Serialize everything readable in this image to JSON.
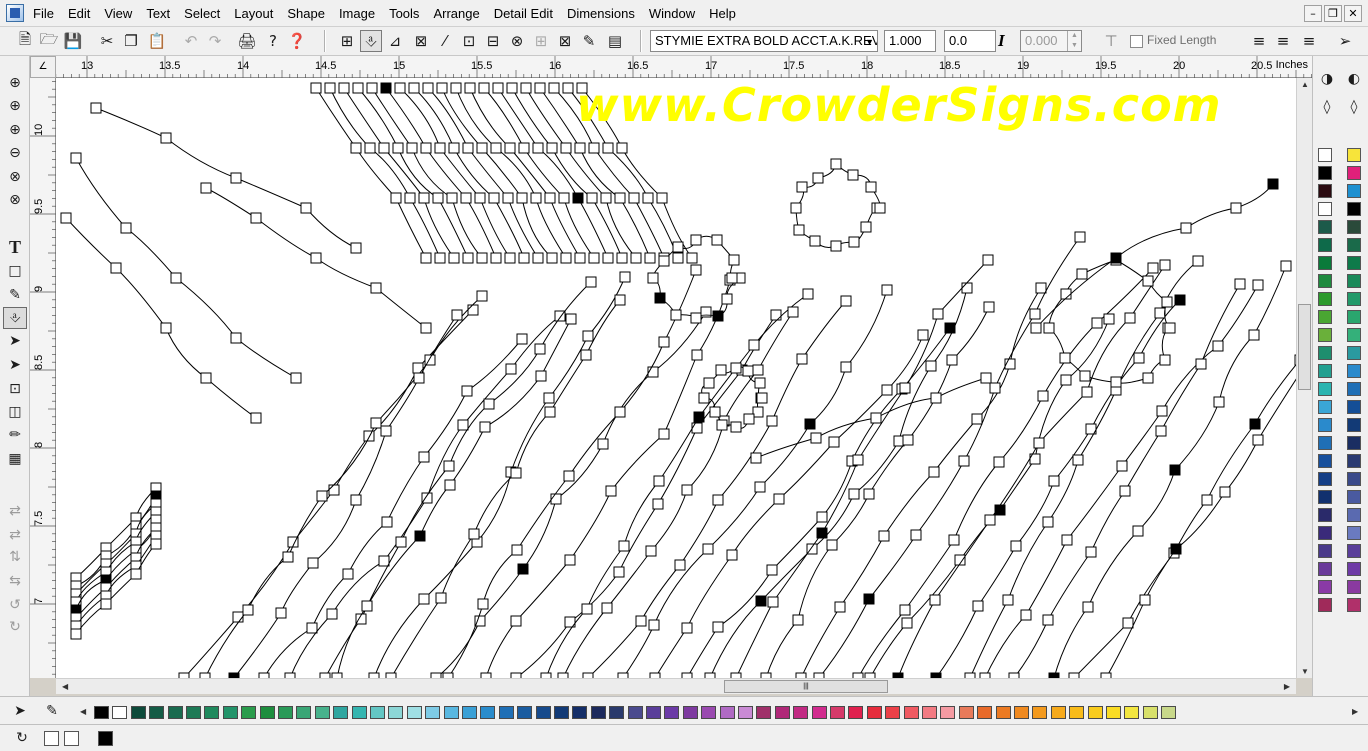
{
  "menubar": {
    "items": [
      "File",
      "Edit",
      "View",
      "Text",
      "Select",
      "Layout",
      "Shape",
      "Image",
      "Tools",
      "Arrange",
      "Detail Edit",
      "Dimensions",
      "Window",
      "Help"
    ]
  },
  "toolbar": {
    "font_name": "STYMIE EXTRA BOLD ACCT.A.K.REV.",
    "text_size": "1.000",
    "italic_angle": "0.0",
    "spacing": "0.000",
    "fixed_length_label": "Fixed Length"
  },
  "ruler": {
    "h_labels": [
      "13",
      "13.5",
      "14",
      "14.5",
      "15",
      "15.5",
      "16",
      "16.5",
      "17",
      "17.5",
      "18",
      "18.5",
      "19",
      "19.5",
      "20",
      "20.5"
    ],
    "units": "Inches",
    "v_labels": [
      "10",
      "9.5",
      "9",
      "8.5",
      "8",
      "7.5",
      "7"
    ]
  },
  "watermark": "www.CrowderSigns.com",
  "colors": {
    "palette": [
      "#000000",
      "#ffffff",
      "#0d4a3a",
      "#145c46",
      "#1a6b4f",
      "#1e7a56",
      "#208a5e",
      "#23946a",
      "#2a9c4c",
      "#1e8e3e",
      "#2a9a58",
      "#3aa676",
      "#47b28c",
      "#2fa6a0",
      "#35b5b0",
      "#63c6c4",
      "#8cd6d6",
      "#9fdfe4",
      "#7ecbe6",
      "#58b7e0",
      "#3aa0d6",
      "#2a8ccc",
      "#1f6fb6",
      "#1a5ca0",
      "#164a8c",
      "#123a76",
      "#142e68",
      "#1c2a5c",
      "#2a3a6c",
      "#4a4a8e",
      "#5a3e9a",
      "#6b3aa6",
      "#7e3aa0",
      "#9a4ab0",
      "#b06ac4",
      "#c98ad4",
      "#a0306a",
      "#b02878",
      "#c22a84",
      "#d12b8e",
      "#d63a6a",
      "#e0204e",
      "#e62c3c",
      "#ec4048",
      "#f05a62",
      "#f27a82",
      "#f49aa2",
      "#e87a5a",
      "#e86a2a",
      "#ec7a22",
      "#f08a20",
      "#f39a1e",
      "#f6aa1c",
      "#f8bb1a",
      "#f9cc1e",
      "#fadc24",
      "#f2e640",
      "#d8e06a",
      "#c8d88a"
    ],
    "right_palette": [
      "#ffffff",
      "#000000",
      "#2a0a10",
      "#ffffff",
      "#1c5a4a",
      "#0e6a4a",
      "#0a7a3a",
      "#1e8a3e",
      "#2c9a2c",
      "#4aa632",
      "#6ab03a",
      "#1e8e6e",
      "#22a090",
      "#2ab4b0",
      "#3aa6d6",
      "#2a8acc",
      "#1f6fb6",
      "#174f9c",
      "#143e86",
      "#11306e",
      "#2a2a6a",
      "#3a2a7a",
      "#4a3a8a",
      "#6a3a9a",
      "#8a3aa6",
      "#a02a5a"
    ],
    "right_palette_b": [
      "#f7e43a",
      "#e0207a",
      "#1e90d0",
      "#000000",
      "#2a4a3a",
      "#1a6a4a",
      "#0e7a4a",
      "#1a8a5a",
      "#229a6a",
      "#2aa66e",
      "#34b07a",
      "#2a9aa0",
      "#2a8acc",
      "#1f6fb6",
      "#144e96",
      "#123a76",
      "#1a2e62",
      "#2a3a72",
      "#3a4a8a",
      "#4a5aa0",
      "#5a6ab0",
      "#6a7ac0",
      "#5a3e9a",
      "#6e3aa6",
      "#8a3aa0",
      "#b0306a"
    ]
  }
}
